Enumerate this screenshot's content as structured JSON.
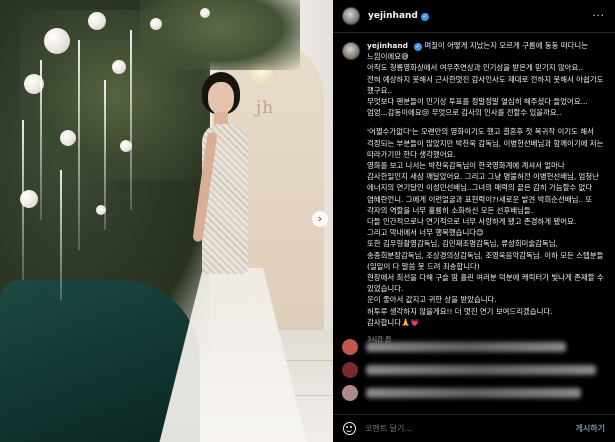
{
  "photo": {
    "logo_text": "jh",
    "next_glyph": "›"
  },
  "post": {
    "username": "yejinhand",
    "more_glyph": "···",
    "caption_username": "yejinhand",
    "caption_lines": [
      "며칠이 어떻게 지났는지 모르게 구름에 둥둥 떠다니는 느낌이에요😅",
      "아직도 청룡영화상에서 여우주연상과 인기상을 받은게 믿기지 않아요..",
      "전혀 예상하지 못해서 근사한멋진 감사인사도 제대로 전하지 못해서 아쉽기도 했구요..",
      "무엇보다 팬분들이 인기상 투표를 정말정말 열심히 해주셨다 들었어요...엄엉...감동이에요😢 무엇으로 감사의 인사를 전할수 있을까요..",
      "",
      "'어쩔수가없다'는 오랜만의 영화이기도 했고 결혼후 첫 복귀작 이기도 해서 걱정되는 부분들이 많았지만 박찬욱 감독님, 이병헌선배님과 함께이기에 저는 따라가기만 한다 생각했어요.",
      "영화를 보고 나서는 박찬욱감독님이 한국영화계에 계셔서 얼마나 감사한일인지 새삼 깨달았어요. 그리고 그냥 명불허전 이병헌선배님, 엄청난 에너지의 연기달인 이성민선배님..그녀의 매력의 끝은 감히 가늠할수 없다 염혜란언니. 그에게 이런얼굴과 표현력이?!새로운 발견 박희순선배님.. 또 각자의 역할을 너무 훌륭히 소화하신 모든 선후배님들.",
      "다들 인간적으로나 연기적으로 너무 사랑하게 됐고 존경하게 됐어요.",
      "그리고 막내에서 너무 행복했습니다😊",
      "또한 김우형촬영감독님, 김민재조명감독님, 류성희미술감독님, 송종희분장감독님, 조상경의상감독님, 조영욱음악감독님. 이하 모든 스텝분들 (일일이 다 말씀 못 드려 죄송합니다)",
      "현장에서 최선을 다해 구슬 땀 흘린 여러분 덕분에 캐릭터가 빛나게 존재할 수 있었습니다.",
      "운이 좋아서 값지고 귀한 상을 받았습니다.",
      "허투루 생각하지 않을게요!! 더 멋진 연기 보여드리겠습니다.",
      "감사합니다🙏💗"
    ],
    "time_label": "3시간 전"
  },
  "comment_bar": {
    "placeholder": "코멘트 달기...",
    "post_label": "게시하기"
  },
  "colors": {
    "background": "#000000",
    "verified": "#3897f0",
    "muted_text": "#a8a8a8",
    "post_button": "#7a8ca8"
  }
}
